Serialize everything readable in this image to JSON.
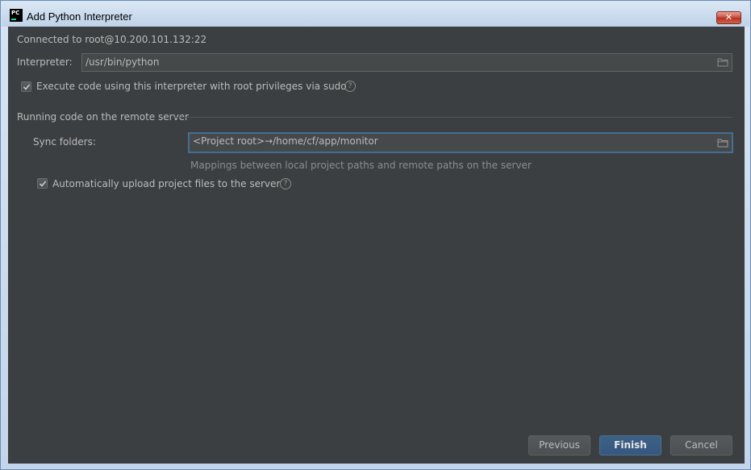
{
  "window": {
    "title": "Add Python Interpreter",
    "app_icon_text": "PC",
    "close_glyph": "✕"
  },
  "connection": {
    "text": "Connected to root@10.200.101.132:22"
  },
  "interpreter": {
    "label": "Interpreter:",
    "value": "/usr/bin/python"
  },
  "sudo": {
    "label": "Execute code using this interpreter with root privileges via sudo",
    "checked": true
  },
  "remote_section": {
    "title": "Running code on the remote server"
  },
  "sync": {
    "label": "Sync folders:",
    "value": "<Project root>→/home/cf/app/monitor",
    "hint": "Mappings between local project paths and remote paths on the server"
  },
  "auto_upload": {
    "label": "Automatically upload project files to the server",
    "checked": true
  },
  "help_glyph": "?",
  "buttons": {
    "previous": "Previous",
    "finish": "Finish",
    "cancel": "Cancel"
  },
  "icons": {
    "folder": "folder-icon",
    "help": "help-icon",
    "check": "checkmark-icon",
    "close": "close-icon"
  },
  "colors": {
    "background": "#3c3f41",
    "field": "#45494a",
    "focus_border": "#466d94",
    "primary_button": "#365880",
    "text": "#bbbbbb"
  }
}
